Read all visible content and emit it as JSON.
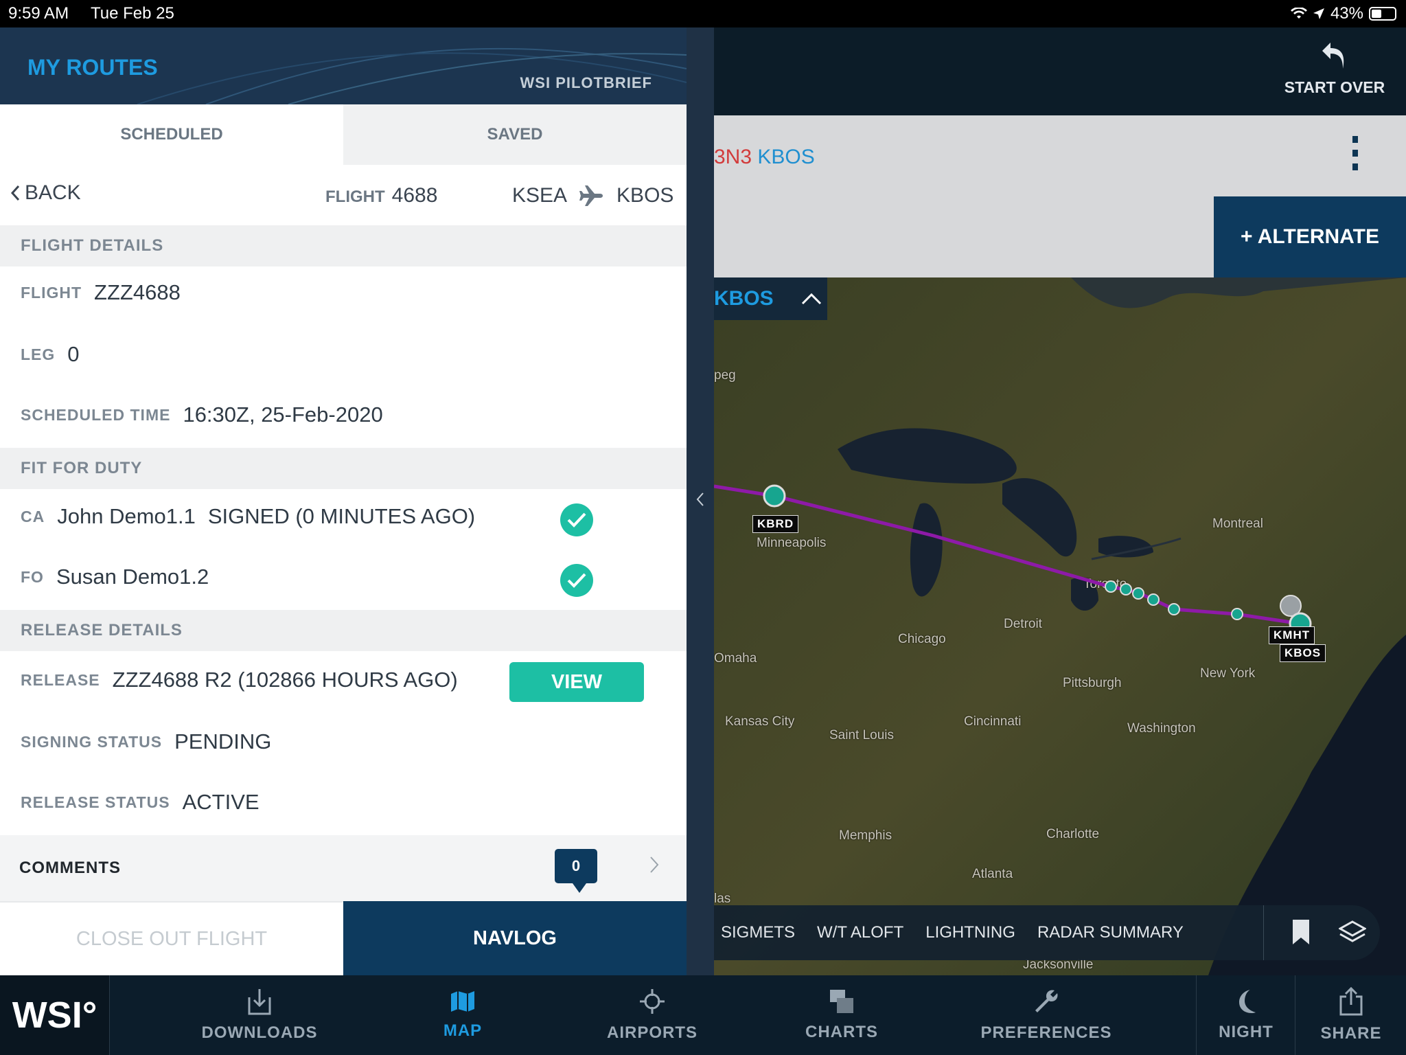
{
  "status_bar": {
    "time": "9:59 AM",
    "date": "Tue Feb 25",
    "battery": "43%"
  },
  "map": {
    "start_over_label": "START OVER",
    "route_partial_red": "3N3",
    "route_partial_blue": "KBOS",
    "alternate_label": "+ ALTERNATE",
    "destination_tab": "KBOS",
    "airport_tags": [
      "KBRD",
      "KMHT",
      "KBOS"
    ],
    "places": [
      "peg",
      "Minneapolis",
      "Montreal",
      "Toronto",
      "Detroit",
      "Chicago",
      "Omaha",
      "New York",
      "Pittsburgh",
      "Kansas City",
      "Cincinnati",
      "Washington",
      "Saint Louis",
      "Charlotte",
      "Memphis",
      "Atlanta",
      "las",
      "Jacksonville"
    ],
    "layers": [
      "SIGMETS",
      "W/T ALOFT",
      "LIGHTNING",
      "RADAR SUMMARY"
    ]
  },
  "panel": {
    "title": "MY ROUTES",
    "brand": "WSI PILOTBRIEF",
    "tabs": [
      "SCHEDULED",
      "SAVED"
    ],
    "back_label": "BACK",
    "flight_label": "FLIGHT",
    "flight_number": "4688",
    "origin": "KSEA",
    "destination": "KBOS",
    "flight_details": {
      "header": "FLIGHT DETAILS",
      "flight_label": "FLIGHT",
      "flight_value": "ZZZ4688",
      "leg_label": "LEG",
      "leg_value": "0",
      "sched_label": "SCHEDULED TIME",
      "sched_value": "16:30Z, 25-Feb-2020"
    },
    "fit_for_duty": {
      "header": "FIT FOR DUTY",
      "ca_label": "CA",
      "ca_name": "John Demo1.1",
      "ca_status": "SIGNED (0 MINUTES AGO)",
      "fo_label": "FO",
      "fo_name": "Susan Demo1.2"
    },
    "release_details": {
      "header": "RELEASE DETAILS",
      "release_label": "RELEASE",
      "release_value": "ZZZ4688 R2 (102866 HOURS AGO)",
      "view_label": "VIEW",
      "signing_label": "SIGNING STATUS",
      "signing_value": "PENDING",
      "release_status_label": "RELEASE STATUS",
      "release_status_value": "ACTIVE"
    },
    "comments": {
      "label": "COMMENTS",
      "count": "0"
    },
    "close_out_label": "CLOSE OUT FLIGHT",
    "navlog_label": "NAVLOG"
  },
  "tabbar": {
    "logo": "WSI°",
    "items": [
      "DOWNLOADS",
      "MAP",
      "AIRPORTS",
      "CHARTS",
      "PREFERENCES",
      "NIGHT",
      "SHARE"
    ]
  }
}
